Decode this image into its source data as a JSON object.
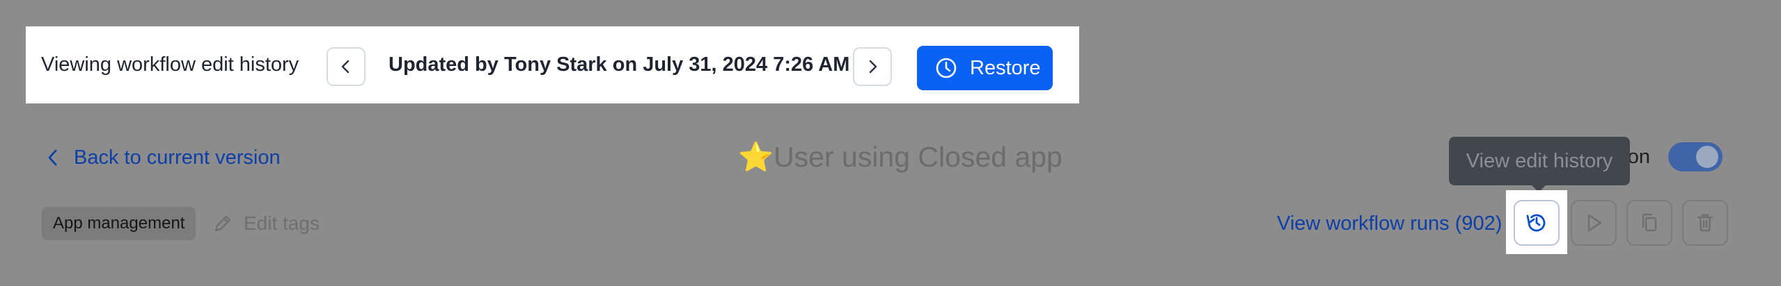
{
  "history_bar": {
    "label": "Viewing workflow edit history",
    "updated_text": "Updated by Tony Stark on July 31, 2024 7:26 AM",
    "restore_label": "Restore",
    "prev_icon": "chevron-left-icon",
    "next_icon": "chevron-right-icon",
    "restore_icon": "clock-icon"
  },
  "header": {
    "back_label": "Back to current version",
    "title_emoji": "⭐",
    "title": "User using Closed app",
    "status_label": "Workflow is on",
    "toggle_on": true
  },
  "tags": {
    "items": [
      "App management"
    ],
    "edit_label": "Edit tags"
  },
  "actions": {
    "view_runs_label": "View workflow runs (902)",
    "tooltip": "View edit history"
  },
  "colors": {
    "accent": "#0a62f5",
    "link": "#0d3fa6",
    "overlay": "#8c8c8c"
  }
}
